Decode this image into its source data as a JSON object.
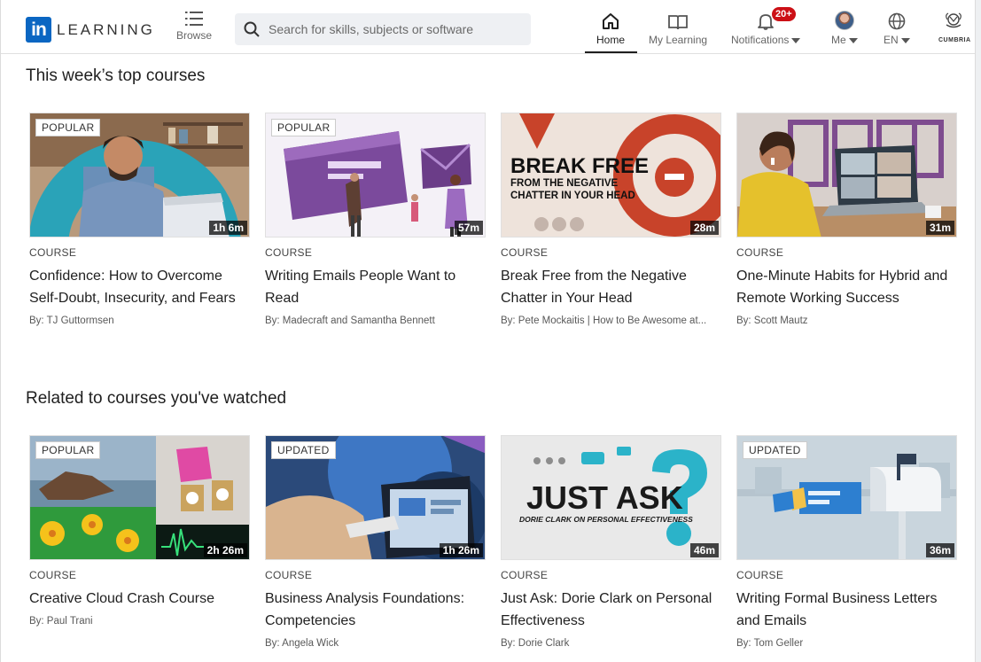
{
  "header": {
    "logo_mark": "in",
    "logo_word": "LEARNING",
    "browse_label": "Browse",
    "search_placeholder": "Search for skills, subjects or software",
    "nav": {
      "home": "Home",
      "my_learning": "My Learning",
      "notifications": "Notifications",
      "notifications_badge": "20+",
      "me": "Me",
      "language": "EN"
    },
    "org_label": "CUMBRIA"
  },
  "sections": [
    {
      "title": "This week’s top courses",
      "courses": [
        {
          "tag": "POPULAR",
          "duration": "1h 6m",
          "type": "COURSE",
          "title": "Confidence: How to Overcome Self-Doubt, Insecurity, and Fears",
          "author": "By: TJ Guttormsen"
        },
        {
          "tag": "POPULAR",
          "duration": "57m",
          "type": "COURSE",
          "title": "Writing Emails People Want to Read",
          "author": "By: Madecraft and Samantha Bennett"
        },
        {
          "tag": "",
          "duration": "28m",
          "type": "COURSE",
          "title": "Break Free from the Negative Chatter in Your Head",
          "author": "By: Pete Mockaitis | How to Be Awesome at...",
          "thumb_text": [
            "BREAK FREE",
            "FROM THE NEGATIVE",
            "CHATTER IN YOUR HEAD"
          ]
        },
        {
          "tag": "",
          "duration": "31m",
          "type": "COURSE",
          "title": "One-Minute Habits for Hybrid and Remote Working Success",
          "author": "By: Scott Mautz"
        }
      ]
    },
    {
      "title": "Related to courses you've watched",
      "courses": [
        {
          "tag": "POPULAR",
          "duration": "2h 26m",
          "type": "COURSE",
          "title": "Creative Cloud Crash Course",
          "author": "By: Paul Trani"
        },
        {
          "tag": "UPDATED",
          "duration": "1h 26m",
          "type": "COURSE",
          "title": "Business Analysis Foundations: Competencies",
          "author": "By: Angela Wick"
        },
        {
          "tag": "",
          "duration": "46m",
          "type": "COURSE",
          "title": "Just Ask: Dorie Clark on Personal Effectiveness",
          "author": "By: Dorie Clark",
          "thumb_text": [
            "JUST ASK",
            "DORIE CLARK ON PERSONAL EFFECTIVENESS"
          ]
        },
        {
          "tag": "UPDATED",
          "duration": "36m",
          "type": "COURSE",
          "title": "Writing Formal Business Letters and Emails",
          "author": "By: Tom Geller"
        }
      ]
    }
  ],
  "colors": {
    "brand": "#0a66c2",
    "badge": "#cc1016",
    "break_free_orange": "#c8432a",
    "just_ask_teal": "#2bb3c9"
  }
}
